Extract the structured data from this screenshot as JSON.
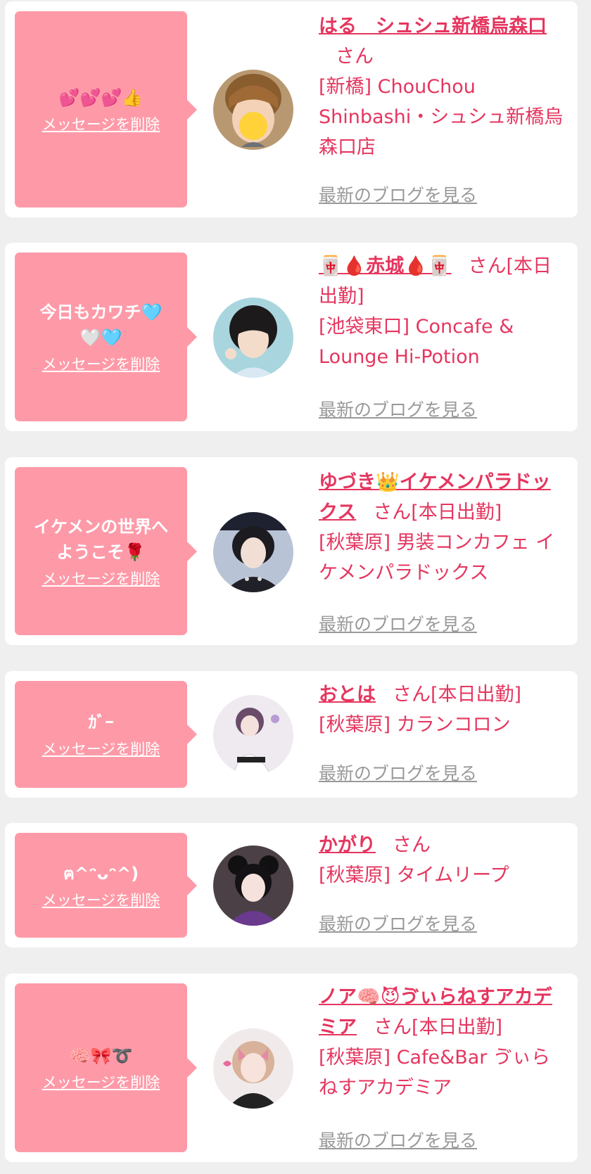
{
  "colors": {
    "page_bg": "#efefef",
    "card_bg": "#ffffff",
    "bubble": "#fe9aa8",
    "accent_text": "#e5365f",
    "link_gray": "#999999"
  },
  "entries": [
    {
      "message": "💕💕💕👍",
      "delete_label": "メッセージを削除",
      "name": "はる　シュシュ新橋烏森口",
      "honorific": "さん",
      "status": "",
      "shop": "[新橋] ChouChou Shinbashi・シュシュ新橋烏森口店",
      "blog_label": "最新のブログを見る",
      "avatar_icon": "avatar-short-hair-heart-emoji"
    },
    {
      "message": "今日もカワチ🩵\n🤍🩵",
      "delete_label": "メッセージを削除",
      "name": "🀄🩸赤城🩸🀄",
      "honorific": "さん",
      "status": "[本日出勤]",
      "shop": "[池袋東口] Concafe & Lounge Hi-Potion",
      "blog_label": "最新のブログを見る",
      "avatar_icon": "avatar-black-bob-hair"
    },
    {
      "message": "イケメンの世界へ\nようこそ🌹",
      "delete_label": "メッセージを削除",
      "name": "ゆづき👑イケメンパラドックス",
      "honorific": "さん",
      "status": "[本日出勤]",
      "shop": "[秋葉原] 男装コンカフェ イケメンパラドックス",
      "blog_label": "最新のブログを見る",
      "avatar_icon": "avatar-dark-costume"
    },
    {
      "message": "ｶﾞｰ",
      "delete_label": "メッセージを削除",
      "name": "おとは",
      "honorific": "さん",
      "status": "[本日出勤]",
      "shop": "[秋葉原] カランコロン",
      "blog_label": "最新のブログを見る",
      "avatar_icon": "avatar-white-outfit"
    },
    {
      "message": "ฅ^ᵔᴗᵔ^)",
      "delete_label": "メッセージを削除",
      "name": "かがり",
      "honorific": "さん",
      "status": "",
      "shop": "[秋葉原] タイムリープ",
      "blog_label": "最新のブログを見る",
      "avatar_icon": "avatar-twin-tails-purple"
    },
    {
      "message": "🧠🎀➰",
      "delete_label": "メッセージを削除",
      "name": "ノア🧠😈ゔぃらねすアカデミア",
      "honorific": "さん",
      "status": "[本日出勤]",
      "shop": "[秋葉原] Cafe&Bar ゔぃらねすアカデミア",
      "blog_label": "最新のブログを見る",
      "avatar_icon": "avatar-pink-hair-bow"
    }
  ]
}
